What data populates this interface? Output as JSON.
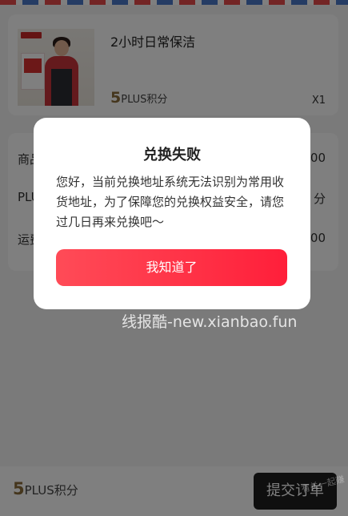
{
  "product": {
    "name": "2小时日常保洁",
    "points_value": "5",
    "points_unit": "PLUS积分",
    "quantity": "X1"
  },
  "summary": {
    "rows": [
      {
        "label": "商品",
        "value": "00"
      },
      {
        "label": "PLUS",
        "value": "分"
      },
      {
        "label": "运费",
        "value": "00"
      }
    ]
  },
  "bottom_bar": {
    "points_value": "5",
    "points_unit": "PLUS积分",
    "submit_label": "提交订单"
  },
  "dialog": {
    "title": "兑换失败",
    "message": "您好，当前兑换地址系统无法识别为常用收货地址，为了保障您的兑换权益安全，请您过几日再来兑换吧～",
    "button_label": "我知道了"
  },
  "watermark": {
    "text": "线报酷-new.xianbao.fun",
    "corner_text": "有关一起赚"
  },
  "colors": {
    "accent": "#ff2a3f",
    "points": "#8a6d3b",
    "submit_bg": "#1e1e1e"
  }
}
